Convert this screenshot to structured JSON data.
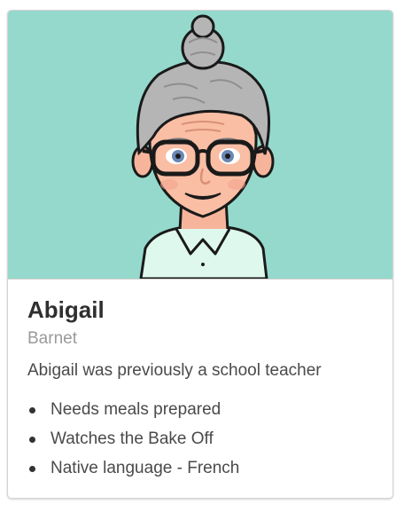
{
  "card": {
    "name": "Abigail",
    "location": "Barnet",
    "bio": "Abigail was previously a school teacher",
    "traits": [
      "Needs meals prepared",
      "Watches the Bake Off",
      "Native language - French"
    ]
  },
  "avatar": {
    "icon": "elderly-woman-avatar",
    "background": "#95d9cc"
  }
}
